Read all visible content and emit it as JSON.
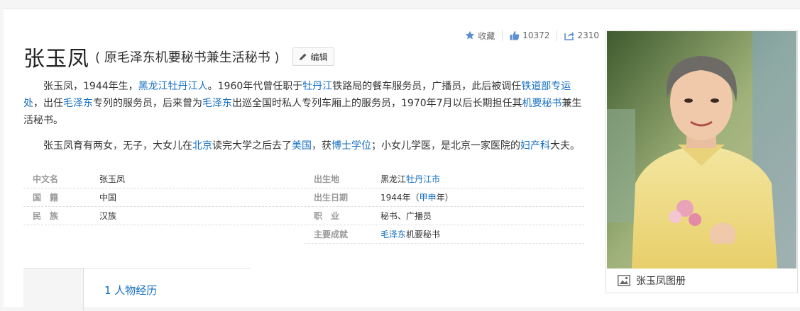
{
  "toolbar": {
    "collect_label": "收藏",
    "like_count": "10372",
    "share_count": "2310"
  },
  "header": {
    "title": "张玉凤",
    "subtitle": "( 原毛泽东机要秘书兼生活秘书 )",
    "edit_label": "编辑"
  },
  "summary": {
    "p1": [
      {
        "t": "张玉凤，1944年生，",
        "link": false
      },
      {
        "t": "黑龙江",
        "link": true
      },
      {
        "t": "牡丹江",
        "link": true
      },
      {
        "t": "人",
        "link": true
      },
      {
        "t": "。1960年代曾任职于",
        "link": false
      },
      {
        "t": "牡丹江",
        "link": true
      },
      {
        "t": "铁路局的餐车服务员，广播员，此后被调任",
        "link": false
      },
      {
        "t": "铁道部",
        "link": true
      },
      {
        "t": "专运处",
        "link": true
      },
      {
        "t": "，出任",
        "link": false
      },
      {
        "t": "毛泽东",
        "link": true
      },
      {
        "t": "专列的服务员，后来曾为",
        "link": false
      },
      {
        "t": "毛泽东",
        "link": true
      },
      {
        "t": "出巡全国时私人专列车厢上的服务员，1970年7月以后长期担任其",
        "link": false
      },
      {
        "t": "机要秘书",
        "link": true
      },
      {
        "t": "兼生活秘书。",
        "link": false
      }
    ],
    "p2": [
      {
        "t": "张玉凤育有两女，无子，大女儿在",
        "link": false
      },
      {
        "t": "北京",
        "link": true
      },
      {
        "t": "读完大学之后去了",
        "link": false
      },
      {
        "t": "美国",
        "link": true
      },
      {
        "t": "，获",
        "link": false
      },
      {
        "t": "博士学位",
        "link": true
      },
      {
        "t": "；小女儿学医，是北京一家医院的",
        "link": false
      },
      {
        "t": "妇产科",
        "link": true
      },
      {
        "t": "大夫。",
        "link": false
      }
    ]
  },
  "basic_info": {
    "left": [
      {
        "key": "中文名",
        "value": [
          {
            "t": "张玉凤",
            "link": false
          }
        ]
      },
      {
        "key": "国　籍",
        "value": [
          {
            "t": "中国",
            "link": false
          }
        ]
      },
      {
        "key": "民　族",
        "value": [
          {
            "t": "汉族",
            "link": false
          }
        ]
      }
    ],
    "right": [
      {
        "key": "出生地",
        "value": [
          {
            "t": "黑龙江",
            "link": false
          },
          {
            "t": "牡丹江市",
            "link": true
          }
        ]
      },
      {
        "key": "出生日期",
        "value": [
          {
            "t": "1944年（",
            "link": false
          },
          {
            "t": "甲申",
            "link": true
          },
          {
            "t": "年）",
            "link": false
          }
        ]
      },
      {
        "key": "职　业",
        "value": [
          {
            "t": "秘书、广播员",
            "link": false
          }
        ]
      },
      {
        "key": "主要成就",
        "value": [
          {
            "t": "毛泽东",
            "link": true
          },
          {
            "t": "机要秘书",
            "link": false
          }
        ]
      }
    ]
  },
  "toc": {
    "first_item": "1  人物经历"
  },
  "album": {
    "caption": "张玉凤图册"
  },
  "colors": {
    "link": "#136ec2",
    "icon": "#5b8fd1"
  }
}
